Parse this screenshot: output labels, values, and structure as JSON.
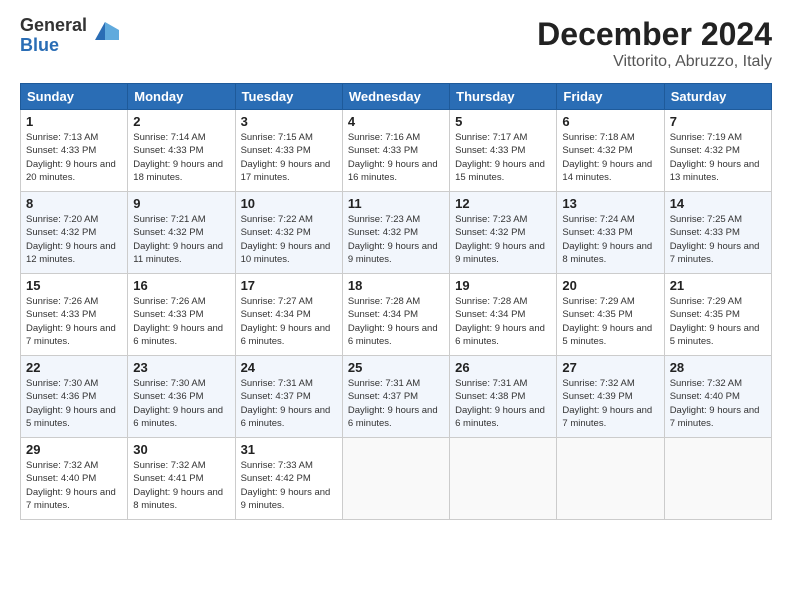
{
  "logo": {
    "general": "General",
    "blue": "Blue"
  },
  "header": {
    "month": "December 2024",
    "location": "Vittorito, Abruzzo, Italy"
  },
  "weekdays": [
    "Sunday",
    "Monday",
    "Tuesday",
    "Wednesday",
    "Thursday",
    "Friday",
    "Saturday"
  ],
  "weeks": [
    [
      {
        "day": "1",
        "sunrise": "7:13 AM",
        "sunset": "4:33 PM",
        "daylight": "9 hours and 20 minutes."
      },
      {
        "day": "2",
        "sunrise": "7:14 AM",
        "sunset": "4:33 PM",
        "daylight": "9 hours and 18 minutes."
      },
      {
        "day": "3",
        "sunrise": "7:15 AM",
        "sunset": "4:33 PM",
        "daylight": "9 hours and 17 minutes."
      },
      {
        "day": "4",
        "sunrise": "7:16 AM",
        "sunset": "4:33 PM",
        "daylight": "9 hours and 16 minutes."
      },
      {
        "day": "5",
        "sunrise": "7:17 AM",
        "sunset": "4:33 PM",
        "daylight": "9 hours and 15 minutes."
      },
      {
        "day": "6",
        "sunrise": "7:18 AM",
        "sunset": "4:32 PM",
        "daylight": "9 hours and 14 minutes."
      },
      {
        "day": "7",
        "sunrise": "7:19 AM",
        "sunset": "4:32 PM",
        "daylight": "9 hours and 13 minutes."
      }
    ],
    [
      {
        "day": "8",
        "sunrise": "7:20 AM",
        "sunset": "4:32 PM",
        "daylight": "9 hours and 12 minutes."
      },
      {
        "day": "9",
        "sunrise": "7:21 AM",
        "sunset": "4:32 PM",
        "daylight": "9 hours and 11 minutes."
      },
      {
        "day": "10",
        "sunrise": "7:22 AM",
        "sunset": "4:32 PM",
        "daylight": "9 hours and 10 minutes."
      },
      {
        "day": "11",
        "sunrise": "7:23 AM",
        "sunset": "4:32 PM",
        "daylight": "9 hours and 9 minutes."
      },
      {
        "day": "12",
        "sunrise": "7:23 AM",
        "sunset": "4:32 PM",
        "daylight": "9 hours and 9 minutes."
      },
      {
        "day": "13",
        "sunrise": "7:24 AM",
        "sunset": "4:33 PM",
        "daylight": "9 hours and 8 minutes."
      },
      {
        "day": "14",
        "sunrise": "7:25 AM",
        "sunset": "4:33 PM",
        "daylight": "9 hours and 7 minutes."
      }
    ],
    [
      {
        "day": "15",
        "sunrise": "7:26 AM",
        "sunset": "4:33 PM",
        "daylight": "9 hours and 7 minutes."
      },
      {
        "day": "16",
        "sunrise": "7:26 AM",
        "sunset": "4:33 PM",
        "daylight": "9 hours and 6 minutes."
      },
      {
        "day": "17",
        "sunrise": "7:27 AM",
        "sunset": "4:34 PM",
        "daylight": "9 hours and 6 minutes."
      },
      {
        "day": "18",
        "sunrise": "7:28 AM",
        "sunset": "4:34 PM",
        "daylight": "9 hours and 6 minutes."
      },
      {
        "day": "19",
        "sunrise": "7:28 AM",
        "sunset": "4:34 PM",
        "daylight": "9 hours and 6 minutes."
      },
      {
        "day": "20",
        "sunrise": "7:29 AM",
        "sunset": "4:35 PM",
        "daylight": "9 hours and 5 minutes."
      },
      {
        "day": "21",
        "sunrise": "7:29 AM",
        "sunset": "4:35 PM",
        "daylight": "9 hours and 5 minutes."
      }
    ],
    [
      {
        "day": "22",
        "sunrise": "7:30 AM",
        "sunset": "4:36 PM",
        "daylight": "9 hours and 5 minutes."
      },
      {
        "day": "23",
        "sunrise": "7:30 AM",
        "sunset": "4:36 PM",
        "daylight": "9 hours and 6 minutes."
      },
      {
        "day": "24",
        "sunrise": "7:31 AM",
        "sunset": "4:37 PM",
        "daylight": "9 hours and 6 minutes."
      },
      {
        "day": "25",
        "sunrise": "7:31 AM",
        "sunset": "4:37 PM",
        "daylight": "9 hours and 6 minutes."
      },
      {
        "day": "26",
        "sunrise": "7:31 AM",
        "sunset": "4:38 PM",
        "daylight": "9 hours and 6 minutes."
      },
      {
        "day": "27",
        "sunrise": "7:32 AM",
        "sunset": "4:39 PM",
        "daylight": "9 hours and 7 minutes."
      },
      {
        "day": "28",
        "sunrise": "7:32 AM",
        "sunset": "4:40 PM",
        "daylight": "9 hours and 7 minutes."
      }
    ],
    [
      {
        "day": "29",
        "sunrise": "7:32 AM",
        "sunset": "4:40 PM",
        "daylight": "9 hours and 7 minutes."
      },
      {
        "day": "30",
        "sunrise": "7:32 AM",
        "sunset": "4:41 PM",
        "daylight": "9 hours and 8 minutes."
      },
      {
        "day": "31",
        "sunrise": "7:33 AM",
        "sunset": "4:42 PM",
        "daylight": "9 hours and 9 minutes."
      },
      null,
      null,
      null,
      null
    ]
  ],
  "labels": {
    "sunrise": "Sunrise:",
    "sunset": "Sunset:",
    "daylight": "Daylight:"
  }
}
